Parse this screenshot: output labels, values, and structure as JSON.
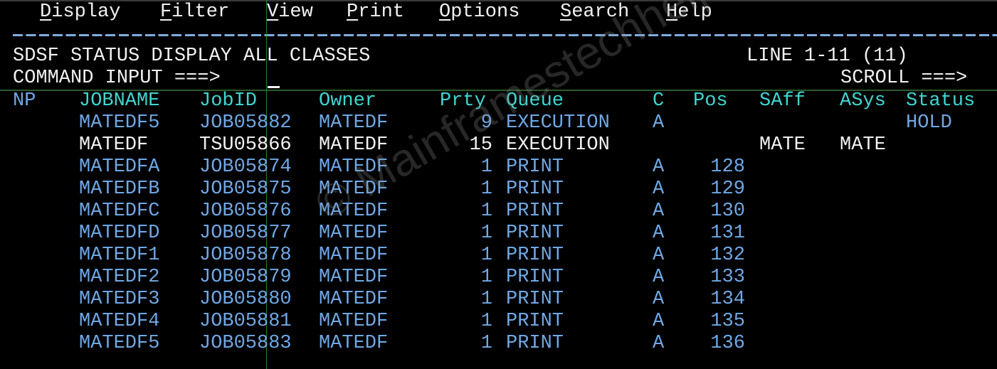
{
  "menu": [
    {
      "hotkey": "D",
      "rest": "isplay"
    },
    {
      "hotkey": "F",
      "rest": "ilter"
    },
    {
      "hotkey": "V",
      "rest": "iew"
    },
    {
      "hotkey": "P",
      "rest": "rint"
    },
    {
      "hotkey": "O",
      "rest": "ptions"
    },
    {
      "hotkey": "S",
      "rest": "earch"
    },
    {
      "hotkey": "H",
      "rest": "elp"
    }
  ],
  "panel": {
    "title": "SDSF STATUS DISPLAY ALL CLASSES",
    "line_info": "LINE 1-11 (11)",
    "command_label": "COMMAND INPUT ===>",
    "command_value": "",
    "scroll_label": "SCROLL ===>",
    "scroll_value": ""
  },
  "table": {
    "columns": [
      "NP",
      "JOBNAME",
      "JobID",
      "Owner",
      "Prty",
      "Queue",
      "C",
      "Pos",
      "SAff",
      "ASys",
      "Status"
    ],
    "rows": [
      {
        "np": "",
        "jobname": "MATEDF5",
        "jobid": "JOB05882",
        "owner": "MATEDF",
        "prty": "9",
        "queue": "EXECUTION",
        "c": "A",
        "pos": "",
        "saff": "",
        "asys": "",
        "status": "HOLD",
        "highlight": false
      },
      {
        "np": "",
        "jobname": "MATEDF",
        "jobid": "TSU05866",
        "owner": "MATEDF",
        "prty": "15",
        "queue": "EXECUTION",
        "c": "",
        "pos": "",
        "saff": "MATE",
        "asys": "MATE",
        "status": "",
        "highlight": true
      },
      {
        "np": "",
        "jobname": "MATEDFA",
        "jobid": "JOB05874",
        "owner": "MATEDF",
        "prty": "1",
        "queue": "PRINT",
        "c": "A",
        "pos": "128",
        "saff": "",
        "asys": "",
        "status": "",
        "highlight": false
      },
      {
        "np": "",
        "jobname": "MATEDFB",
        "jobid": "JOB05875",
        "owner": "MATEDF",
        "prty": "1",
        "queue": "PRINT",
        "c": "A",
        "pos": "129",
        "saff": "",
        "asys": "",
        "status": "",
        "highlight": false
      },
      {
        "np": "",
        "jobname": "MATEDFC",
        "jobid": "JOB05876",
        "owner": "MATEDF",
        "prty": "1",
        "queue": "PRINT",
        "c": "A",
        "pos": "130",
        "saff": "",
        "asys": "",
        "status": "",
        "highlight": false
      },
      {
        "np": "",
        "jobname": "MATEDFD",
        "jobid": "JOB05877",
        "owner": "MATEDF",
        "prty": "1",
        "queue": "PRINT",
        "c": "A",
        "pos": "131",
        "saff": "",
        "asys": "",
        "status": "",
        "highlight": false
      },
      {
        "np": "",
        "jobname": "MATEDF1",
        "jobid": "JOB05878",
        "owner": "MATEDF",
        "prty": "1",
        "queue": "PRINT",
        "c": "A",
        "pos": "132",
        "saff": "",
        "asys": "",
        "status": "",
        "highlight": false
      },
      {
        "np": "",
        "jobname": "MATEDF2",
        "jobid": "JOB05879",
        "owner": "MATEDF",
        "prty": "1",
        "queue": "PRINT",
        "c": "A",
        "pos": "133",
        "saff": "",
        "asys": "",
        "status": "",
        "highlight": false
      },
      {
        "np": "",
        "jobname": "MATEDF3",
        "jobid": "JOB05880",
        "owner": "MATEDF",
        "prty": "1",
        "queue": "PRINT",
        "c": "A",
        "pos": "134",
        "saff": "",
        "asys": "",
        "status": "",
        "highlight": false
      },
      {
        "np": "",
        "jobname": "MATEDF4",
        "jobid": "JOB05881",
        "owner": "MATEDF",
        "prty": "1",
        "queue": "PRINT",
        "c": "A",
        "pos": "135",
        "saff": "",
        "asys": "",
        "status": "",
        "highlight": false
      },
      {
        "np": "",
        "jobname": "MATEDF5",
        "jobid": "JOB05883",
        "owner": "MATEDF",
        "prty": "1",
        "queue": "PRINT",
        "c": "A",
        "pos": "136",
        "saff": "",
        "asys": "",
        "status": "",
        "highlight": false
      }
    ]
  },
  "watermark": "© Mainframestechhelp",
  "colors": {
    "background": "#000000",
    "text_white": "#f2f2f2",
    "text_blue": "#6fa8e6",
    "header_turquoise": "#3fd6d0",
    "separator_blue": "#7faee0",
    "guide_green": "#2f9a2f"
  }
}
